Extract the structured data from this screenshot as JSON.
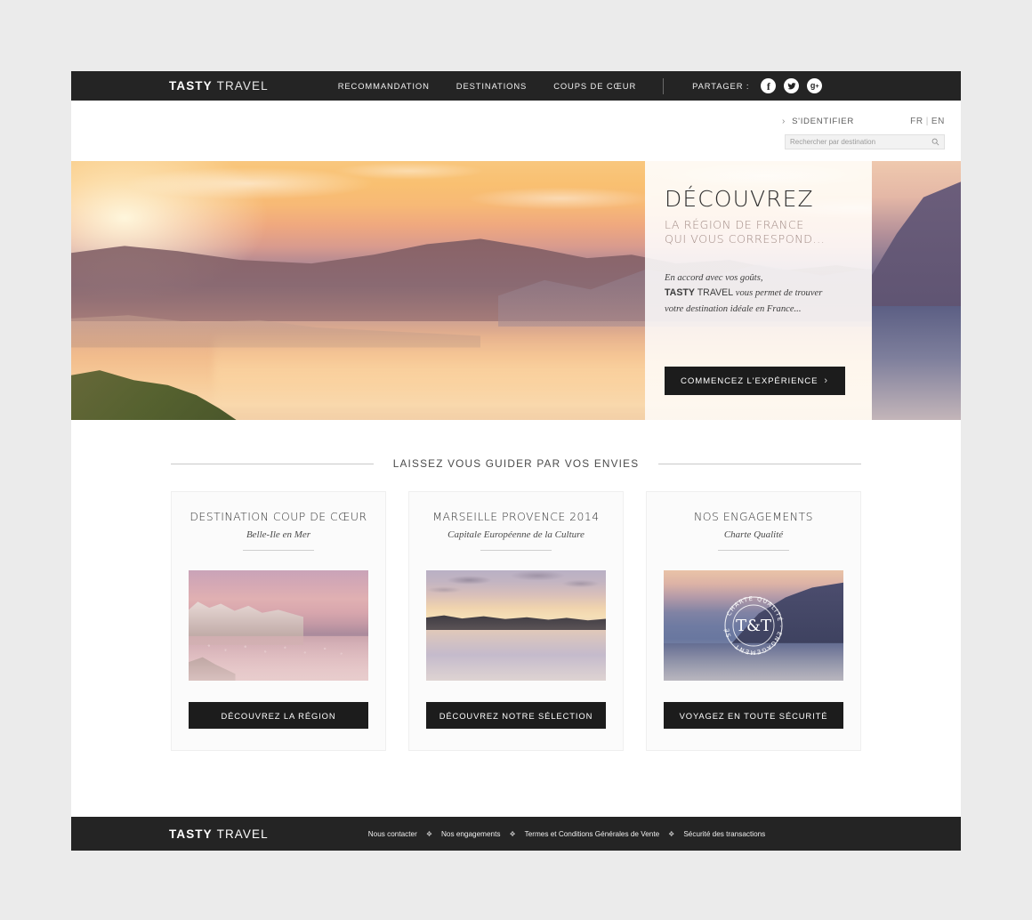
{
  "brand": {
    "bold": "TASTY",
    "light": "TRAVEL"
  },
  "topnav": {
    "items": [
      {
        "label": "RECOMMANDATION",
        "name": "nav-recommandation"
      },
      {
        "label": "DESTINATIONS",
        "name": "nav-destinations"
      },
      {
        "label": "COUPS DE CŒUR",
        "name": "nav-coups-de-coeur"
      }
    ],
    "share_label": "PARTAGER :",
    "social": [
      {
        "name": "facebook-icon",
        "glyph": "f"
      },
      {
        "name": "twitter-icon",
        "glyph": "t"
      },
      {
        "name": "google-plus-icon",
        "glyph": "g+"
      }
    ]
  },
  "subheader": {
    "signin_label": "S'IDENTIFIER",
    "chevron": "›",
    "lang_fr": "FR",
    "lang_divider": "|",
    "lang_en": "EN",
    "search_placeholder": "Rechercher par destination",
    "search_value": "",
    "search_icon": "search-icon"
  },
  "hero": {
    "title": "DÉCOUVREZ",
    "subtitle_line1": "LA RÉGION DE FRANCE",
    "subtitle_line2": "QUI VOUS CORRESPOND...",
    "paragraph_line1": "En accord avec vos goûts,",
    "paragraph_brand_bold": "TASTY",
    "paragraph_brand_light": " TRAVEL",
    "paragraph_line2_rest": " vous permet de trouver",
    "paragraph_line3": "votre destination idéale en France...",
    "cta_label": "COMMENCEZ L'EXPÉRIENCE",
    "cta_arrow": "›"
  },
  "section": {
    "title": "LAISSEZ VOUS GUIDER PAR VOS ENVIES"
  },
  "cards": [
    {
      "title": "DESTINATION COUP DE CŒUR",
      "subtitle": "Belle-Ile en Mer",
      "image_name": "belle-ile-harbour-image",
      "button": "DÉCOUVREZ LA RÉGION"
    },
    {
      "title": "MARSEILLE PROVENCE 2014",
      "subtitle": "Capitale Européenne de la Culture",
      "image_name": "marseille-harbour-image",
      "button": "DÉCOUVREZ NOTRE SÉLECTION"
    },
    {
      "title": "NOS ENGAGEMENTS",
      "subtitle": "Charte Qualité",
      "image_name": "quality-seal-image",
      "button": "VOYAGEZ EN TOUTE SÉCURITÉ"
    }
  ],
  "seal": {
    "center": "T&T",
    "ring_text": "CHARTE QUALITÉ · ENGAGEMENT · SÉCURITÉ ·"
  },
  "footer": {
    "links": [
      {
        "label": "Nous contacter",
        "name": "footer-link-contact"
      },
      {
        "label": "Nos engagements",
        "name": "footer-link-engagements"
      },
      {
        "label": "Termes et Conditions Générales de Vente",
        "name": "footer-link-terms"
      },
      {
        "label": "Sécurité des transactions",
        "name": "footer-link-security"
      }
    ],
    "separator": "❖"
  },
  "colors": {
    "dark": "#242424",
    "button": "#1c1c1c",
    "accent_muted": "#a08a84",
    "page_bg": "#ebebeb"
  }
}
